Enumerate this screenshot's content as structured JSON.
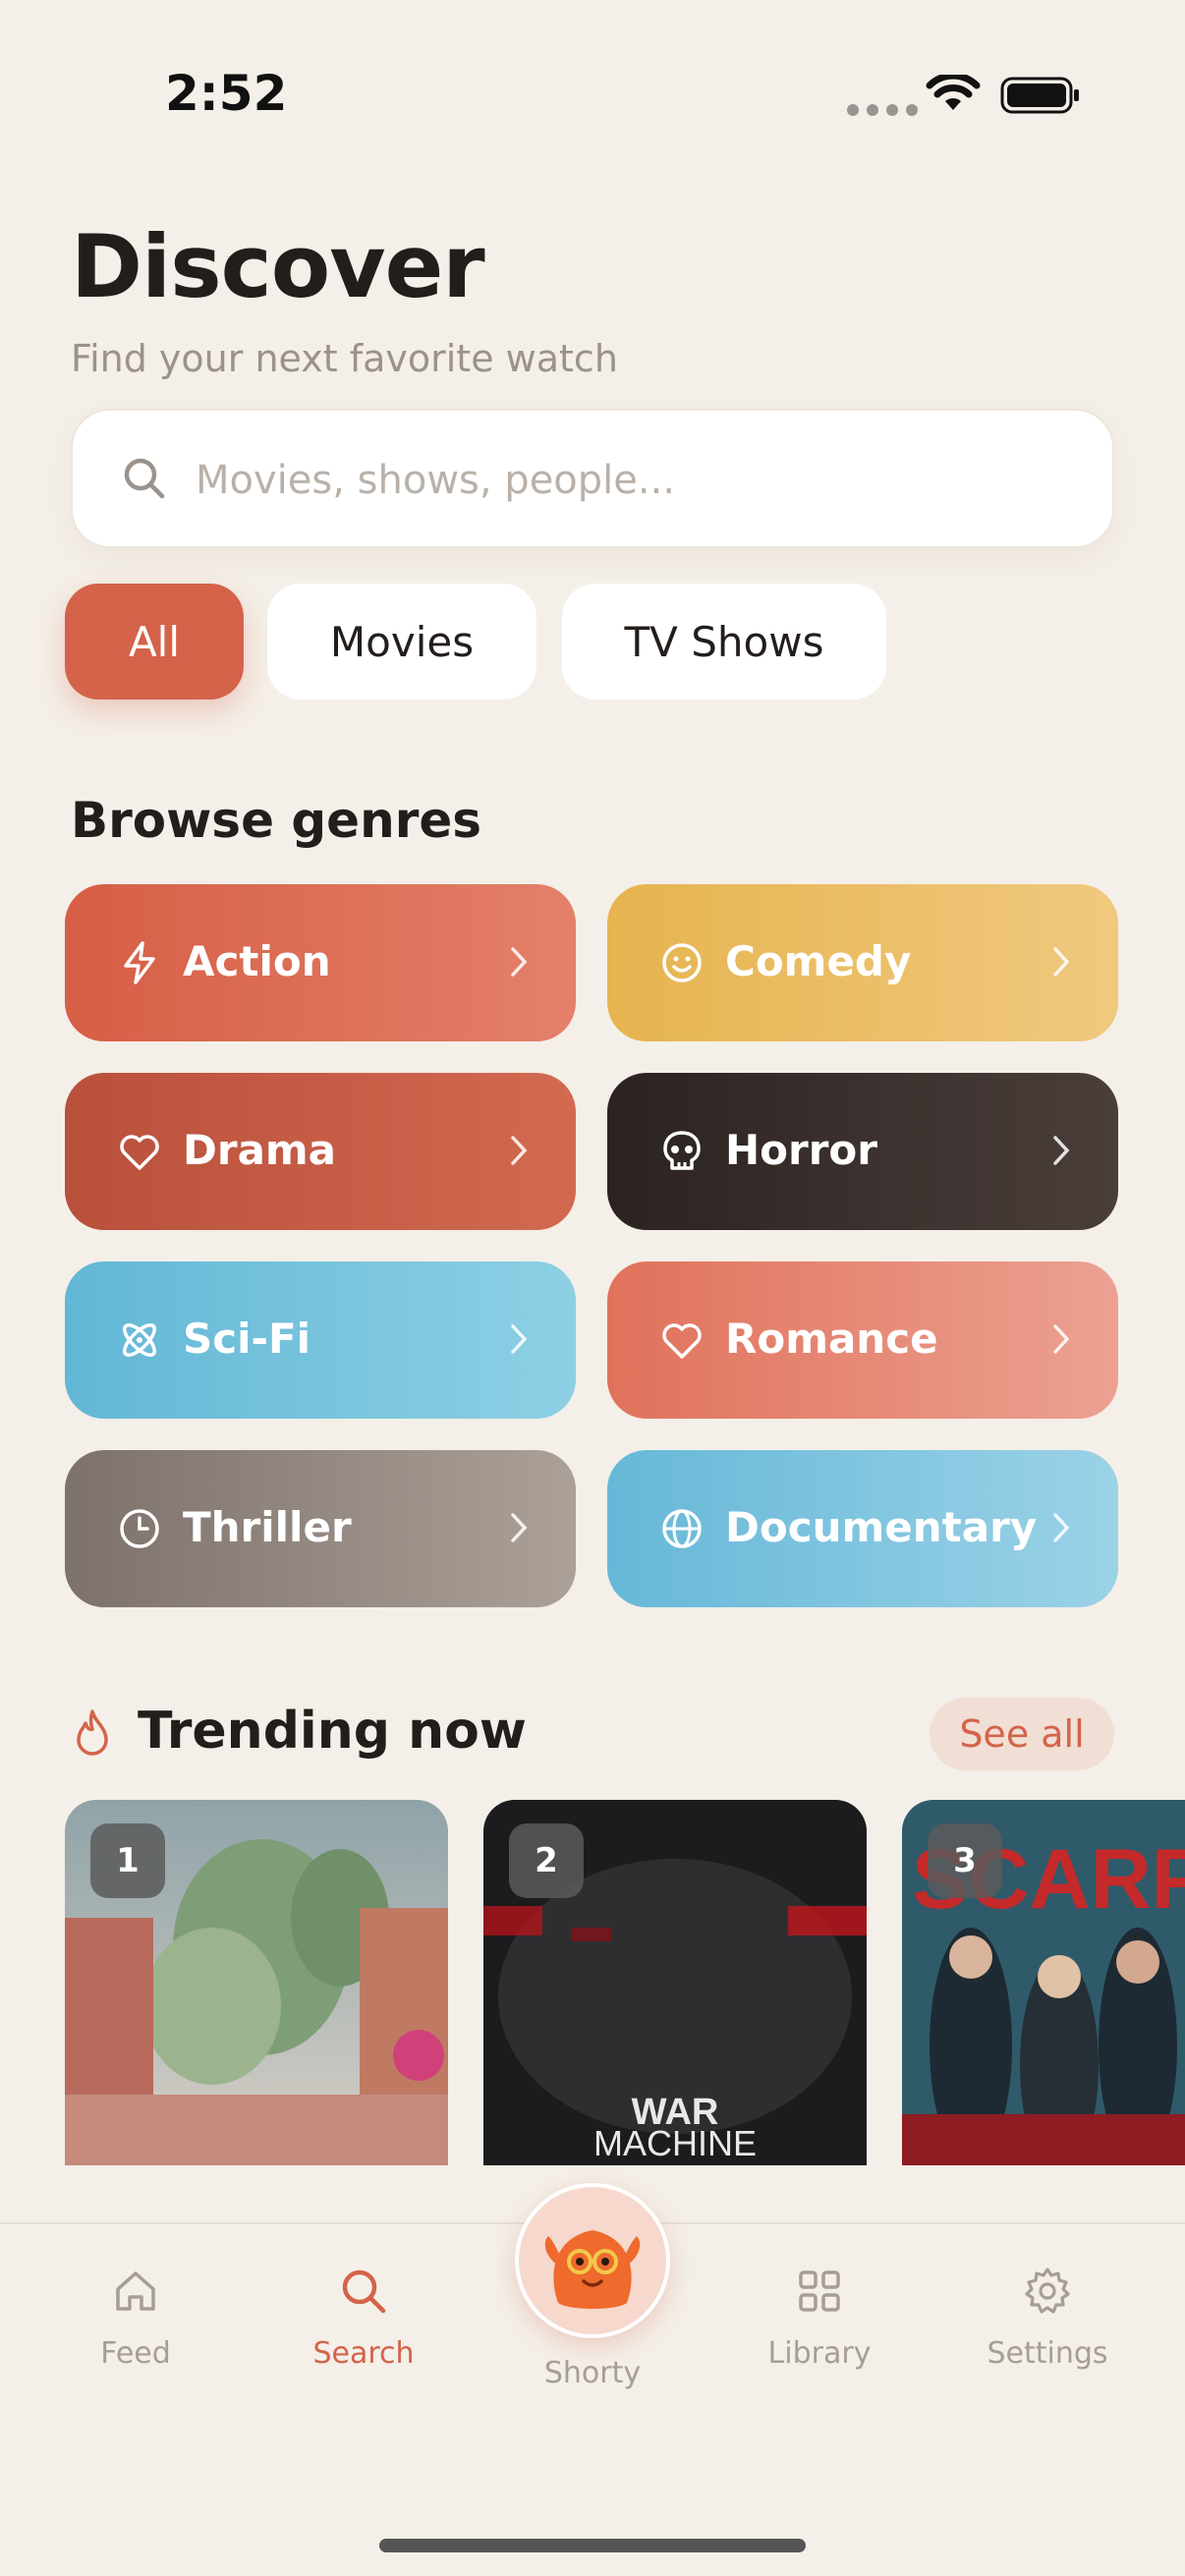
{
  "status": {
    "time": "2:52"
  },
  "header": {
    "title": "Discover",
    "subtitle": "Find your next favorite watch"
  },
  "search": {
    "placeholder": "Movies, shows, people..."
  },
  "filters": [
    {
      "label": "All",
      "active": true
    },
    {
      "label": "Movies",
      "active": false
    },
    {
      "label": "TV Shows",
      "active": false
    }
  ],
  "genres_section": {
    "title": "Browse genres"
  },
  "genres": [
    {
      "label": "Action",
      "icon": "bolt-icon",
      "color_from": "#d65e45",
      "color_to": "#e4806a"
    },
    {
      "label": "Comedy",
      "icon": "smile-icon",
      "color_from": "#e6b44f",
      "color_to": "#f0c97f"
    },
    {
      "label": "Drama",
      "icon": "heart-icon",
      "color_from": "#b8503b",
      "color_to": "#d26a51"
    },
    {
      "label": "Horror",
      "icon": "skull-icon",
      "color_from": "#2b2321",
      "color_to": "#4a3e3a"
    },
    {
      "label": "Sci-Fi",
      "icon": "atom-icon",
      "color_from": "#62b7d6",
      "color_to": "#8dd0e4"
    },
    {
      "label": "Romance",
      "icon": "heart-icon",
      "color_from": "#e0725b",
      "color_to": "#eca192"
    },
    {
      "label": "Thriller",
      "icon": "clock-icon",
      "color_from": "#7d716b",
      "color_to": "#aba198"
    },
    {
      "label": "Documentary",
      "icon": "globe-icon",
      "color_from": "#66b8d8",
      "color_to": "#9bd2e7"
    }
  ],
  "trending": {
    "title": "Trending now",
    "see_all": "See all",
    "items": [
      {
        "rank": "1"
      },
      {
        "rank": "2",
        "poster_text_1": "WAR",
        "poster_text_2": "MACHINE"
      },
      {
        "rank": "3",
        "poster_text_1": "SCARPET"
      }
    ]
  },
  "tabs": [
    {
      "label": "Feed",
      "icon": "home-icon"
    },
    {
      "label": "Search",
      "icon": "search-icon",
      "active": true
    },
    {
      "label": "Shorty",
      "icon": "mascot-icon"
    },
    {
      "label": "Library",
      "icon": "grid-icon"
    },
    {
      "label": "Settings",
      "icon": "gear-icon"
    }
  ],
  "colors": {
    "accent": "#d4634a",
    "background": "#f4efe8"
  }
}
